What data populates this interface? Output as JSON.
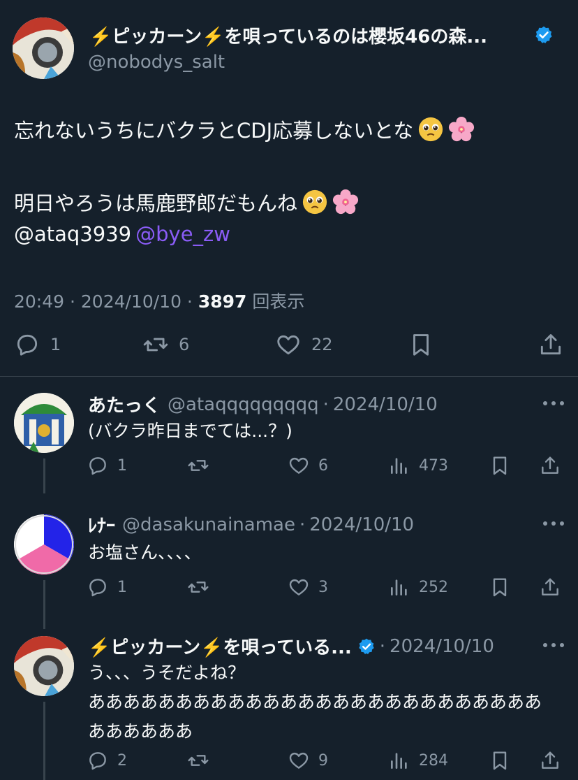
{
  "main_tweet": {
    "display_name": "⚡️ピッカーン⚡️を唄っているのは櫻坂46の森...",
    "handle": "@nobodys_salt",
    "line1": "忘れないうちにバクラとCDJ応募しないとな",
    "line2": "明日やろうは馬鹿野郎だもんね",
    "mention1": "@ataq3939",
    "mention2": "@bye_zw",
    "time": "20:49 · 2024/10/10 · ",
    "views": "3897",
    "views_label": " 回表示",
    "replies": "1",
    "retweets": "6",
    "likes": "22"
  },
  "replies": [
    {
      "name": "あたっく",
      "handle": "@ataqqqqqqqqq",
      "date": "2024/10/10",
      "lines": [
        "(バクラ昨日までては...？)"
      ],
      "replies": "1",
      "retweets": "",
      "likes": "6",
      "views": "473"
    },
    {
      "name": "ﾚﾅｰ",
      "handle": "@dasakunainamae",
      "date": "2024/10/10",
      "lines": [
        "お塩さん、、、、"
      ],
      "replies": "1",
      "retweets": "",
      "likes": "3",
      "views": "252"
    },
    {
      "name": "⚡️ピッカーン⚡️を唄っている...",
      "handle": "",
      "date": "2024/10/10",
      "lines": [
        "う、、、うそだよね？",
        "ああああああああああああああああああああああああああ",
        "ああああああ"
      ],
      "replies": "2",
      "retweets": "",
      "likes": "9",
      "views": "284"
    }
  ],
  "colors": {
    "background": "#15202b",
    "text": "#f7f9f9",
    "secondary": "#8b98a5",
    "mention": "#8a5cf6",
    "verified": "#1d9bf0",
    "divider": "#38444d"
  },
  "icons": [
    "verified-badge-icon",
    "pleading-face-emoji",
    "cherry-blossom-emoji",
    "reply-icon",
    "retweet-icon",
    "like-icon",
    "bookmark-icon",
    "share-icon",
    "views-icon",
    "more-icon"
  ]
}
